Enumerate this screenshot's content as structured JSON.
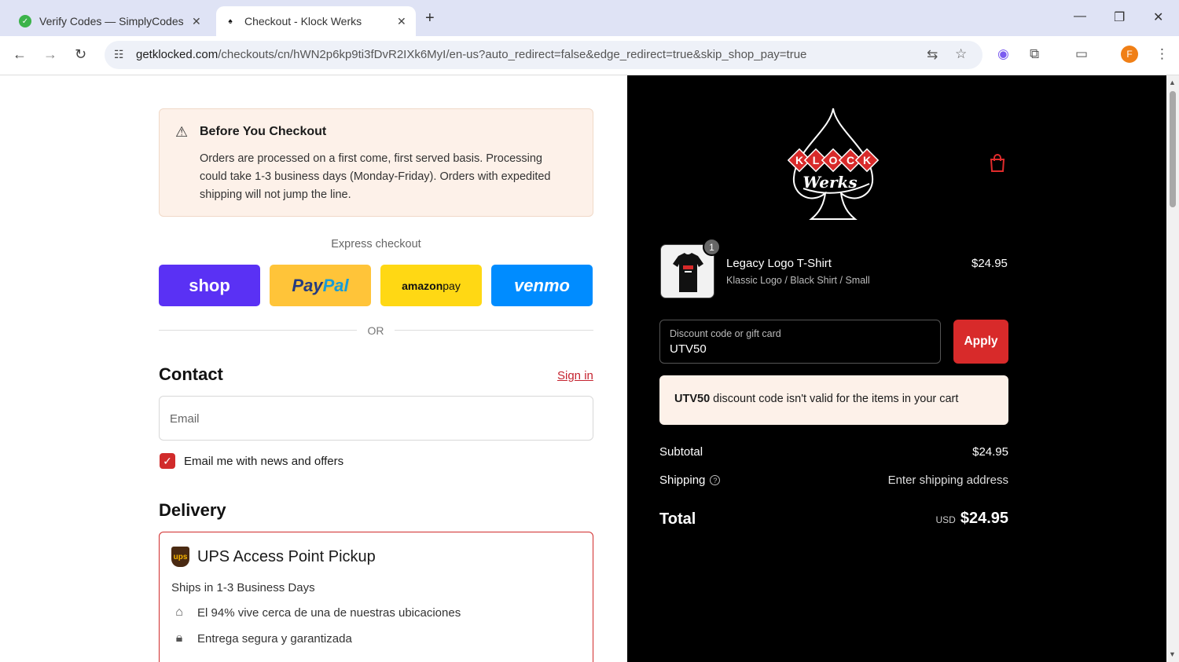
{
  "browser": {
    "tabs": [
      {
        "title": "Verify Codes — SimplyCodes",
        "active": false
      },
      {
        "title": "Checkout - Klock Werks",
        "active": true
      }
    ],
    "url_host": "getklocked.com",
    "url_path": "/checkouts/cn/hWN2p6kp9ti3fDvR2IXk6MyI/en-us?auto_redirect=false&edge_redirect=true&skip_shop_pay=true",
    "profile_initial": "F"
  },
  "notice": {
    "title": "Before You Checkout",
    "body": "Orders are processed on a first come, first served basis. Processing could take 1-3 business days (Monday-Friday). Orders with expedited shipping will not jump the line."
  },
  "express": {
    "label": "Express checkout",
    "or": "OR",
    "shop": "shop",
    "paypal_a": "Pay",
    "paypal_b": "Pal",
    "amazon_a": "amazon",
    "amazon_b": " pay",
    "venmo": "venmo"
  },
  "contact": {
    "heading": "Contact",
    "signin": "Sign in",
    "email_placeholder": "Email",
    "newsletter_label": "Email me with news and offers",
    "newsletter_checked": true
  },
  "delivery": {
    "heading": "Delivery",
    "option_title": "UPS Access Point Pickup",
    "ships": "Ships in 1-3 Business Days",
    "features": [
      "El 94% vive cerca de una de nuestras ubicaciones",
      "Entrega segura y garantizada"
    ]
  },
  "summary": {
    "brand_top": "KLOCK",
    "brand_script": "Werks",
    "item": {
      "name": "Legacy Logo T-Shirt",
      "variant": "Klassic Logo / Black Shirt / Small",
      "price": "$24.95",
      "quantity": "1"
    },
    "discount_label": "Discount code or gift card",
    "discount_value": "UTV50",
    "apply_label": "Apply",
    "error_code": "UTV50",
    "error_text": " discount code isn't valid for the items in your cart",
    "subtotal_label": "Subtotal",
    "subtotal_value": "$24.95",
    "shipping_label": "Shipping",
    "shipping_value": "Enter shipping address",
    "total_label": "Total",
    "total_currency": "USD",
    "total_value": "$24.95"
  },
  "colors": {
    "accent": "#d82a2a",
    "shop": "#5a31f4",
    "paypal": "#ffc439",
    "amazon": "#ffd814",
    "venmo": "#008cff"
  }
}
